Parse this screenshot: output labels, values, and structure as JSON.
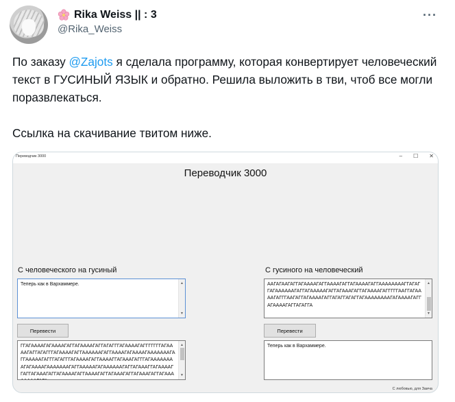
{
  "tweet": {
    "display_name": "Rika Weiss || : 3",
    "handle": "@Rika_Weiss",
    "more_icon": "more-icon",
    "text_line1_pre": "По заказу ",
    "mention": "@Zajots",
    "text_line1_post": " я сделала программу, которая конвертирует человеческий текст в ГУСИНЫЙ ЯЗЫК и обратно. Решила выложить в тви, чтоб все могли поразвлекаться.",
    "text_line2": "Ссылка на скачивание твитом ниже."
  },
  "app": {
    "window_title": "Переводчик 3000",
    "controls": {
      "minimize": "–",
      "maximize": "☐",
      "close": "✕"
    },
    "title": "Переводчик 3000",
    "left": {
      "label": "С человеческого на гусиный",
      "input_value": "Теперь как в Вархаммере.",
      "button": "Перевести",
      "output_value": "ГГАГААААГАГААААГАГГАГААААГАГГАГАГГГАГААААГАГГГГГГГАГААААГАГГАГАГГГАГААААГАГГААААААГАГГААААГАГААААГАААААААГАГГАААААГАГГГАГАГГГАГААААГАГГААААГГАГАААГАГГГАГААААААААГАГААААГАААААААГАГГАААААГАГААААААГАГГАГАААГГАГААААГГАГГАГАААГАГГАГААААГАГГААААГАГГАГАААГАГГАГАААГАГГАГААААААААГАГА"
    },
    "right": {
      "label": "С гусиного на человеческий",
      "input_value": "ААГАГААГАГГАГААААГАГГААААГАГГАГААААГАГГААААААААГГАГАГГАГААААААГАГГАГАААААГАГГАГАААГАГГАГААААГАГГГГГААГГАГААААГАГГГААГАГГАГААААГАГГАГАГГАГАГГАГААААААААГАГААААГАГГАГААААГАГГАГАГГА",
      "button": "Перевести",
      "output_value": "Теперь как в Вархаммере."
    },
    "footer_note": "С любовью, для Заича"
  }
}
